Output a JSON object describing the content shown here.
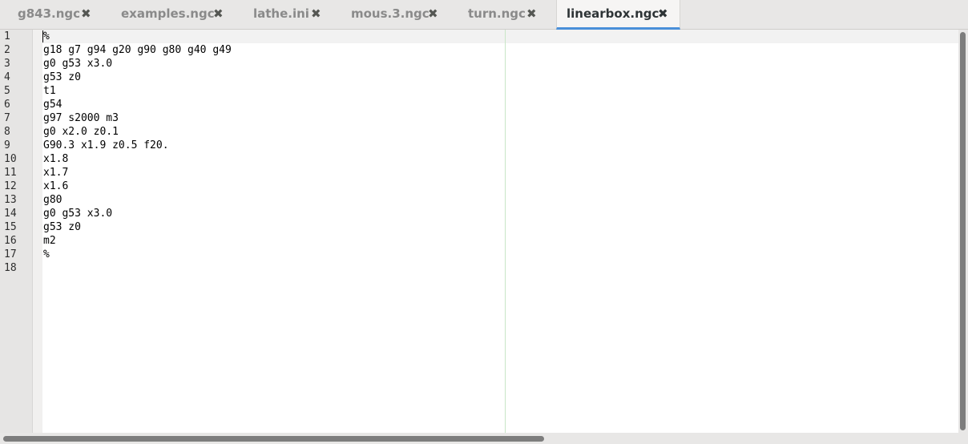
{
  "tabs": [
    {
      "label": "g843.ngc",
      "active": false
    },
    {
      "label": "examples.ngc",
      "active": false
    },
    {
      "label": "lathe.ini",
      "active": false
    },
    {
      "label": "mous.3.ngc",
      "active": false
    },
    {
      "label": "turn.ngc",
      "active": false
    },
    {
      "label": "linearbox.ngc",
      "active": true
    }
  ],
  "close_glyph": "✖",
  "editor": {
    "line_numbers": [
      "1",
      "2",
      "3",
      "4",
      "5",
      "6",
      "7",
      "8",
      "9",
      "10",
      "11",
      "12",
      "13",
      "14",
      "15",
      "16",
      "17",
      "18"
    ],
    "lines": [
      "%",
      "g18 g7 g94 g20 g90 g80 g40 g49",
      "g0 g53 x3.0",
      "g53 z0",
      "t1",
      "g54",
      "g97 s2000 m3",
      "g0 x2.0 z0.1",
      "G90.3 x1.9 z0.5 f20.",
      "x1.8",
      "x1.7",
      "x1.6",
      "g80",
      "g0 g53 x3.0",
      "g53 z0",
      "m2",
      "%",
      ""
    ]
  },
  "colors": {
    "accent": "#4a90d9",
    "right_margin": "#c9e6c7"
  }
}
